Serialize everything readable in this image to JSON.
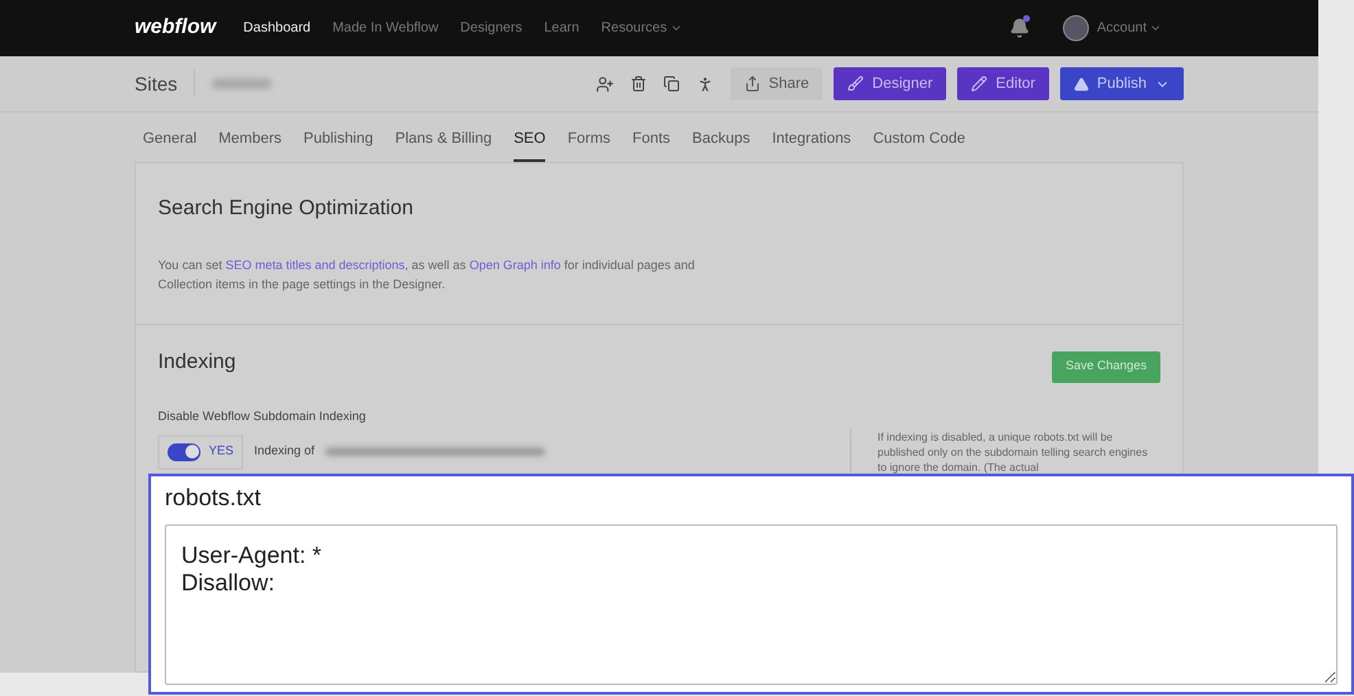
{
  "topnav": {
    "logo": "webflow",
    "links": [
      {
        "label": "Dashboard",
        "selected": true
      },
      {
        "label": "Made In Webflow",
        "selected": false
      },
      {
        "label": "Designers",
        "selected": false
      },
      {
        "label": "Learn",
        "selected": false
      },
      {
        "label": "Resources",
        "selected": false,
        "dropdown": true
      }
    ],
    "notification_dot": true,
    "account": "Account"
  },
  "header": {
    "title": "Sites",
    "buttons": [
      {
        "label": "Share",
        "kind": "plain"
      },
      {
        "label": "Designer",
        "kind": "designer"
      },
      {
        "label": "Editor",
        "kind": "editor"
      },
      {
        "label": "Publish",
        "kind": "publish"
      }
    ]
  },
  "tabs": [
    {
      "label": "General",
      "selected": false
    },
    {
      "label": "Members",
      "selected": false
    },
    {
      "label": "Publishing",
      "selected": false
    },
    {
      "label": "Plans & Billing",
      "selected": false
    },
    {
      "label": "SEO",
      "selected": true
    },
    {
      "label": "Forms",
      "selected": false
    },
    {
      "label": "Fonts",
      "selected": false
    },
    {
      "label": "Backups",
      "selected": false
    },
    {
      "label": "Integrations",
      "selected": false
    },
    {
      "label": "Custom Code",
      "selected": false
    }
  ],
  "seo": {
    "title": "Search Engine Optimization",
    "text_before": "You can set ",
    "link1": "SEO meta titles and descriptions",
    "text_mid": ", as well as ",
    "link2": "Open Graph info",
    "text_after": " for individual pages and Collection items in the page settings in the Designer."
  },
  "indexing": {
    "title": "Indexing",
    "save_button": "Save Changes",
    "setting_label": "Disable Webflow Subdomain Indexing",
    "toggle": {
      "on": true,
      "label": "YES"
    },
    "status_prefix": "Indexing of",
    "help": "If indexing is disabled, a unique robots.txt will be published only on the subdomain telling search engines to ignore the domain. (The actual"
  },
  "robots": {
    "label": "robots.txt",
    "value": "User-Agent: *\nDisallow:"
  }
}
